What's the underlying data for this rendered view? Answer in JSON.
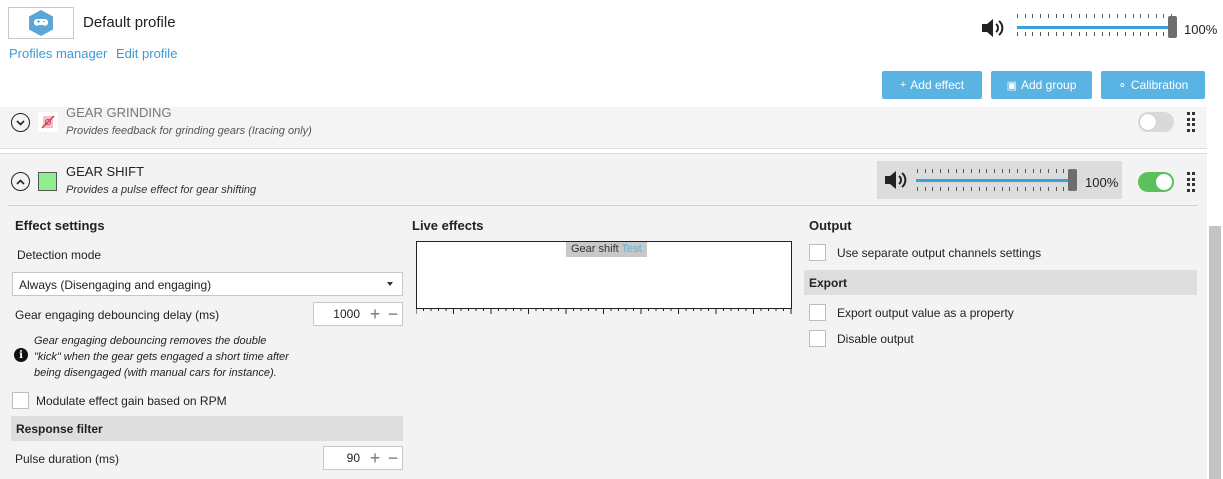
{
  "profile": {
    "name": "Default profile",
    "icon": "gamepad-icon",
    "links": [
      "Profiles manager",
      "Edit profile"
    ]
  },
  "master_volume": {
    "value": 100,
    "text": "100%"
  },
  "toolbar": {
    "add_effect": "Add effect",
    "add_group": "Add group",
    "calibration": "Calibration"
  },
  "effects": [
    {
      "title": "GEAR GRINDING",
      "description": "Provides feedback for grinding gears (Iracing only)",
      "enabled": false,
      "expanded": false
    },
    {
      "title": "GEAR SHIFT",
      "description": "Provides a pulse effect for gear shifting",
      "enabled": true,
      "expanded": true,
      "color": "#90ee90",
      "volume": {
        "value": 100,
        "text": "100%"
      }
    }
  ],
  "effect_settings": {
    "heading": "Effect settings",
    "detection_label": "Detection mode",
    "detection_value": "Always (Disengaging and engaging)",
    "debounce_label": "Gear engaging debouncing delay (ms)",
    "debounce_value": "1000",
    "info_text_1": "Gear engaging debouncing removes the double",
    "info_text_2": "\"kick\" when the gear gets engaged a short time after",
    "info_text_3": "being disengaged (with manual cars for instance).",
    "modulate_label": "Modulate effect gain based on RPM",
    "response_filter": "Response filter",
    "pulse_label": "Pulse duration (ms)",
    "pulse_value": "90"
  },
  "live_effects": {
    "heading": "Live effects",
    "tag": "Gear shift",
    "test": "Test"
  },
  "output": {
    "heading": "Output",
    "separate_label": "Use separate output channels settings",
    "export_band": "Export",
    "export_label": "Export output value as a property",
    "disable_label": "Disable output"
  },
  "colors": {
    "accent": "#3aa0db",
    "button": "#5ab4e3",
    "toggle_on": "#5cc05c",
    "toggle_off": "#d9d9d9"
  }
}
